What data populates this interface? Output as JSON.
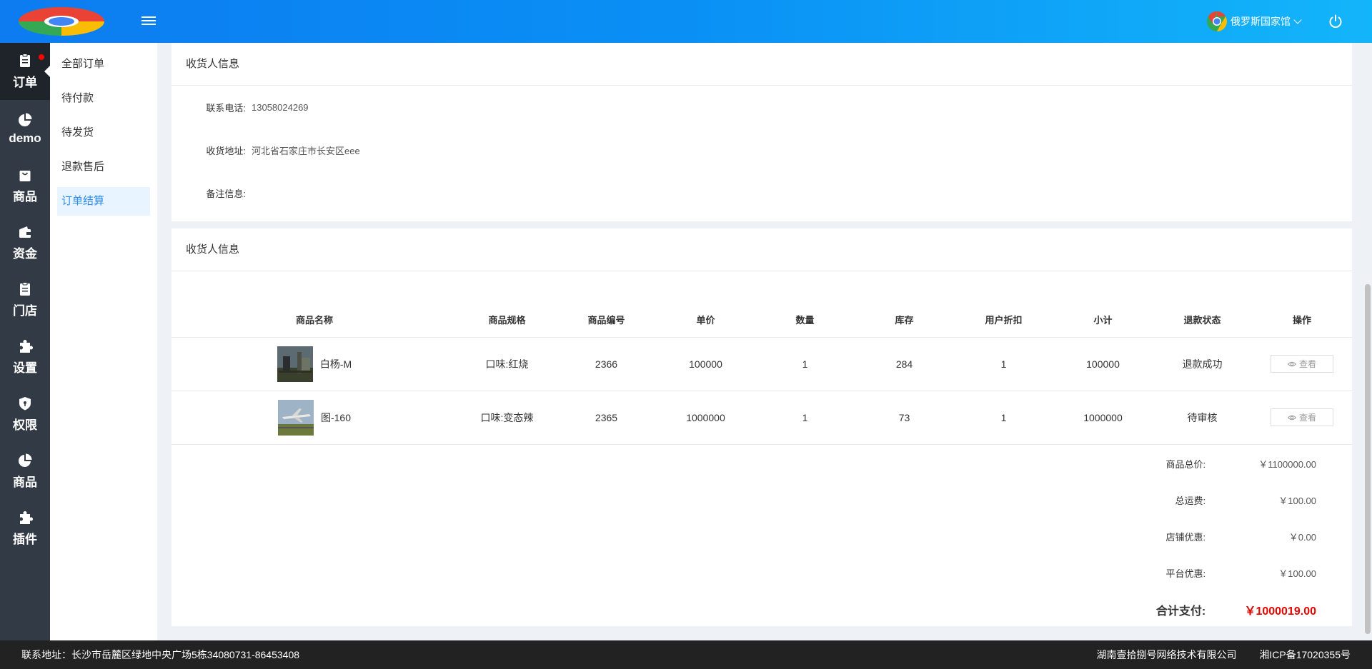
{
  "header": {
    "user_name": "俄罗斯国家馆"
  },
  "iconnav": [
    {
      "label": "订单"
    },
    {
      "label": "demo"
    },
    {
      "label": "商品"
    },
    {
      "label": "资金"
    },
    {
      "label": "门店"
    },
    {
      "label": "设置"
    },
    {
      "label": "权限"
    },
    {
      "label": "商品"
    },
    {
      "label": "插件"
    }
  ],
  "submenu": [
    {
      "label": "全部订单"
    },
    {
      "label": "待付款"
    },
    {
      "label": "待发货"
    },
    {
      "label": "退款售后"
    },
    {
      "label": "订单结算"
    }
  ],
  "receiver": {
    "title": "收货人信息",
    "phone_label": "联系电话:",
    "phone": "13058024269",
    "address_label": "收货地址:",
    "address": "河北省石家庄市长安区eee",
    "note_label": "备注信息:",
    "note": ""
  },
  "goods": {
    "title": "收货人信息",
    "columns": [
      "商品名称",
      "商品规格",
      "商品编号",
      "单价",
      "数量",
      "库存",
      "用户折扣",
      "小计",
      "退款状态",
      "操作"
    ],
    "rows": [
      {
        "name": "白杨-M",
        "spec": "口味:红烧",
        "code": "2366",
        "price": "100000",
        "qty": "1",
        "stock": "284",
        "discount": "1",
        "subtotal": "100000",
        "refund": "退款成功",
        "action": "查看"
      },
      {
        "name": "图-160",
        "spec": "口味:变态辣",
        "code": "2365",
        "price": "1000000",
        "qty": "1",
        "stock": "73",
        "discount": "1",
        "subtotal": "1000000",
        "refund": "待审核",
        "action": "查看"
      }
    ]
  },
  "summary": {
    "total_goods_label": "商品总价:",
    "total_goods": "￥1100000.00",
    "freight_label": "总运费:",
    "freight": "￥100.00",
    "shop_discount_label": "店铺优惠:",
    "shop_discount": "￥0.00",
    "platform_discount_label": "平台优惠:",
    "platform_discount": "￥100.00",
    "pay_label": "合计支付:",
    "pay": "￥1000019.00"
  },
  "footer": {
    "address": "联系地址：长沙市岳麓区绿地中央广场5栋34080731-86453408",
    "company": "湖南壹拾捌号网络技术有限公司",
    "icp": "湘ICP备17020355号"
  },
  "colors": {
    "header_start": "#0c7cf0",
    "header_end": "#13b5fa",
    "nav_bg": "#323a45",
    "accent": "#2d8cf0",
    "pay_red": "#e10602"
  }
}
